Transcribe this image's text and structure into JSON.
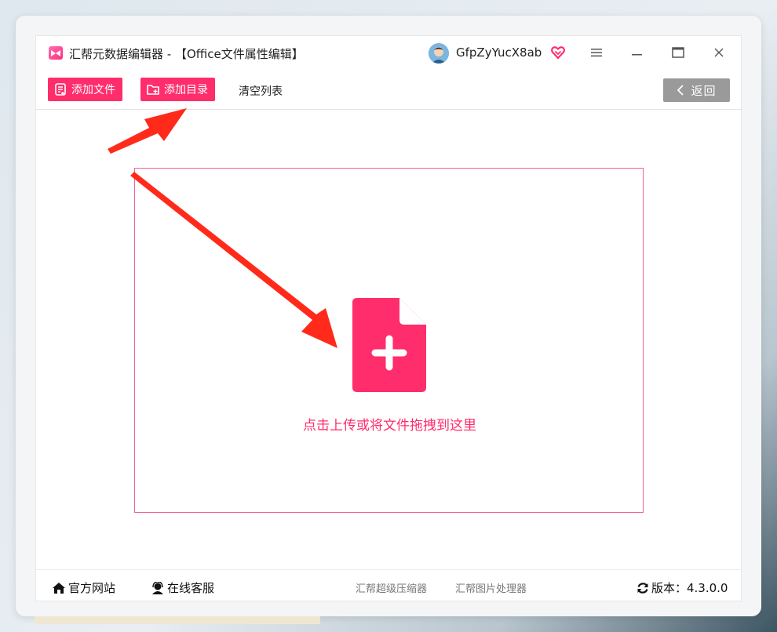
{
  "window": {
    "title": "汇帮元数据编辑器 - 【Office文件属性编辑】",
    "username": "GfpZyYucX8ab",
    "menu_icon": "hamburger-menu-icon",
    "minimize_icon": "minimize-icon",
    "maximize_icon": "maximize-icon",
    "close_icon": "close-icon"
  },
  "toolbar": {
    "add_file": "添加文件",
    "add_folder": "添加目录",
    "clear_list": "清空列表",
    "back": "返回"
  },
  "dropzone": {
    "icon": "file-plus-icon",
    "text": "点击上传或将文件拖拽到这里"
  },
  "footer": {
    "website": "官方网站",
    "support": "在线客服",
    "link1": "汇帮超级压缩器",
    "link2": "汇帮图片处理器",
    "version": "版本：4.3.0.0"
  },
  "colors": {
    "accent": "#ff2d6b",
    "annotation_arrow": "#ff2a1a",
    "back_button": "#9a9a9a"
  }
}
